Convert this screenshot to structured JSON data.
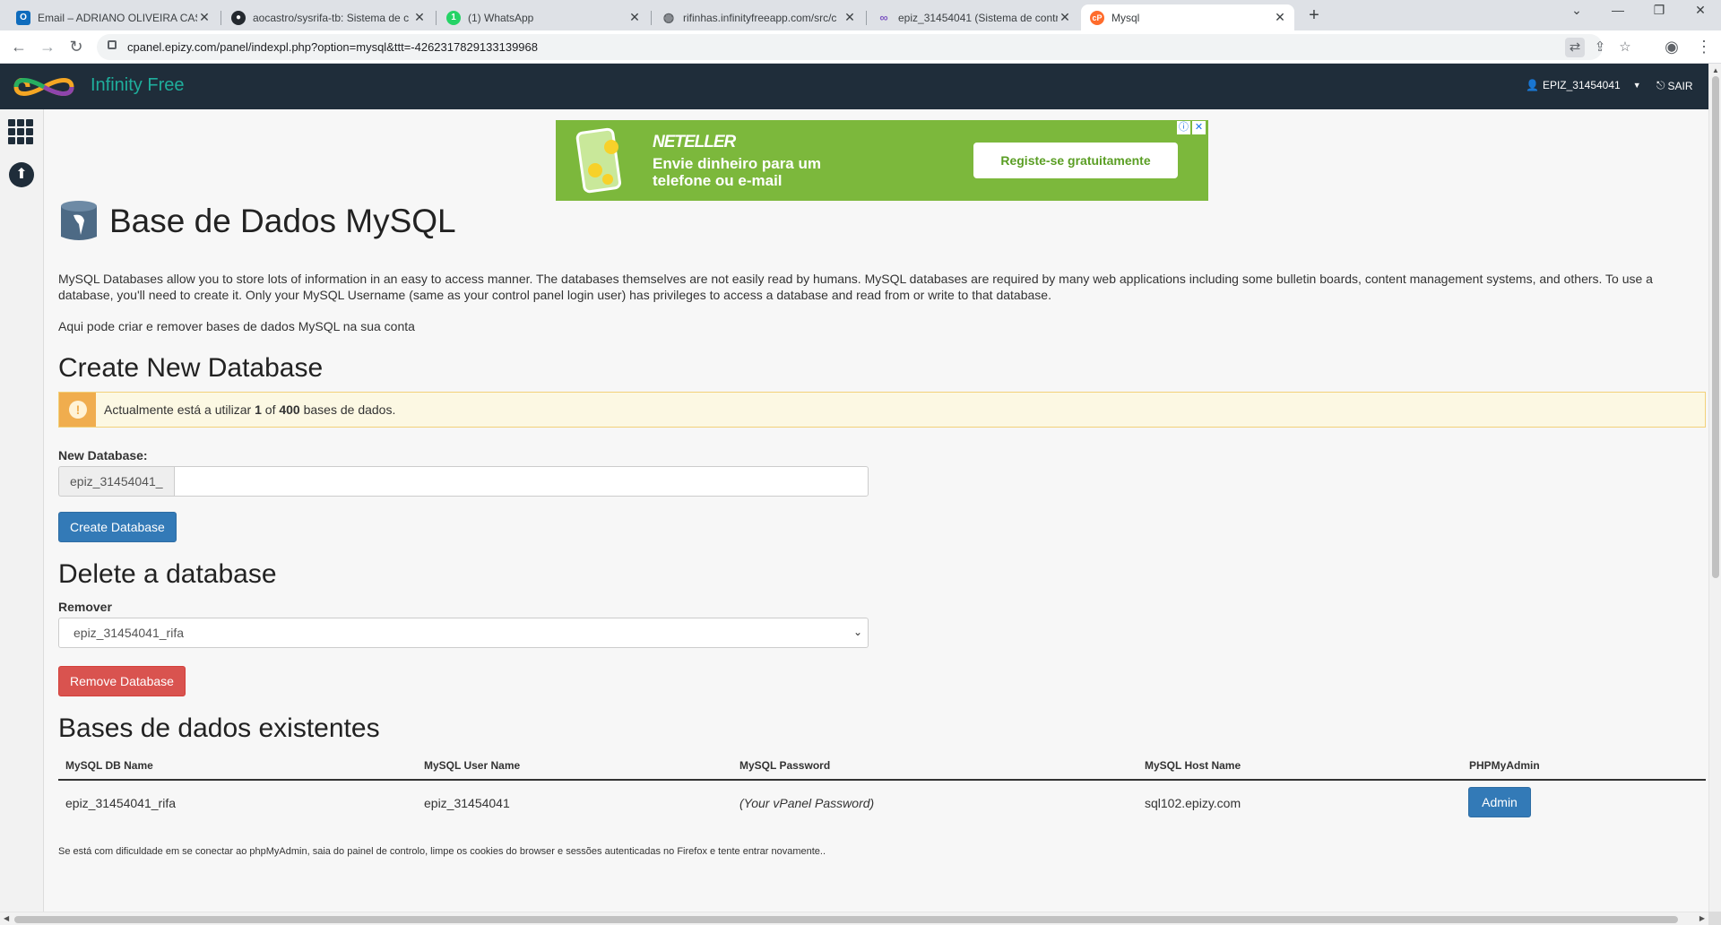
{
  "browser": {
    "tabs": [
      {
        "title": "Email – ADRIANO OLIVEIRA CAST",
        "icon": "outlook-icon",
        "active": false
      },
      {
        "title": "aocastro/sysrifa-tb: Sistema de c",
        "icon": "github-icon",
        "active": false
      },
      {
        "title": "(1) WhatsApp",
        "icon": "whatsapp-icon",
        "active": false
      },
      {
        "title": "rifinhas.infinityfreeapp.com/src/c",
        "icon": "globe-icon",
        "active": false
      },
      {
        "title": "epiz_31454041 (Sistema de contr",
        "icon": "infinityfree-icon",
        "active": false
      },
      {
        "title": "Mysql",
        "icon": "cpanel-icon",
        "active": true
      }
    ],
    "url": "cpanel.epizy.com/panel/indexpl.php?option=mysql&ttt=-4262317829133139968"
  },
  "header": {
    "logo_text": "Infinity Free",
    "username": "EPIZ_31454041",
    "logout_label": "SAIR"
  },
  "ad": {
    "brand": "NETELLER",
    "headline_line1": "Envie dinheiro para um",
    "headline_line2": "telefone ou e-mail",
    "cta": "Registe-se gratuitamente",
    "color": "#7cb83c"
  },
  "page": {
    "title": "Base de Dados MySQL",
    "intro": "MySQL Databases allow you to store lots of information in an easy to access manner. The databases themselves are not easily read by humans. MySQL databases are required by many web applications including some bulletin boards, content management systems, and others. To use a database, you'll need to create it. Only your MySQL Username (same as your control panel login user) has privileges to access a database and read from or write to that database.",
    "intro2": "Aqui pode criar e remover bases de dados MySQL na sua conta"
  },
  "create": {
    "heading": "Create New Database",
    "alert_prefix": "Actualmente está a utilizar ",
    "alert_used": "1",
    "alert_of": " of ",
    "alert_total": "400",
    "alert_suffix": " bases de dados.",
    "label": "New Database:",
    "prefix": "epiz_31454041_",
    "input_value": "",
    "button": "Create Database"
  },
  "delete": {
    "heading": "Delete a database",
    "label": "Remover",
    "selected": "epiz_31454041_rifa",
    "button": "Remove Database"
  },
  "existing": {
    "heading": "Bases de dados existentes",
    "columns": [
      "MySQL DB Name",
      "MySQL User Name",
      "MySQL Password",
      "MySQL Host Name",
      "PHPMyAdmin"
    ],
    "rows": [
      {
        "db": "epiz_31454041_rifa",
        "user": "epiz_31454041",
        "password": "(Your vPanel Password)",
        "host": "sql102.epizy.com",
        "action": "Admin"
      }
    ],
    "footnote": "Se está com dificuldade em se conectar ao phpMyAdmin, saia do painel de controlo, limpe os cookies do browser e sessões autenticadas no Firefox e tente entrar novamente.."
  },
  "colors": {
    "appbar": "#1f2d3a",
    "brand": "#1fae9c",
    "primary": "#337ab7",
    "danger": "#d9534f",
    "warning": "#f0ad4e"
  }
}
